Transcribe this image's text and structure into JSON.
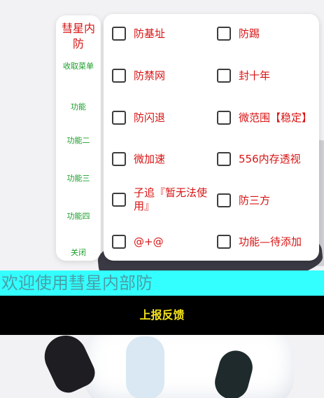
{
  "sidebar": {
    "title": "彗星内防",
    "items": [
      {
        "label": "收取菜单"
      },
      {
        "label": "功能"
      },
      {
        "label": "功能二"
      },
      {
        "label": "功能三"
      },
      {
        "label": "功能四"
      },
      {
        "label": "关闭"
      }
    ]
  },
  "options": [
    {
      "label": "防基址",
      "checked": false
    },
    {
      "label": "防踢",
      "checked": false
    },
    {
      "label": "防禁网",
      "checked": false
    },
    {
      "label": "封十年",
      "checked": false
    },
    {
      "label": "防闪退",
      "checked": false
    },
    {
      "label": "微范围【稳定】",
      "checked": false
    },
    {
      "label": "微加速",
      "checked": false
    },
    {
      "label": "556内存透视",
      "checked": false
    },
    {
      "label": "子追『暂无法使用』",
      "checked": false
    },
    {
      "label": "防三方",
      "checked": false
    },
    {
      "label": "@+@",
      "checked": false
    },
    {
      "label": "功能—待添加",
      "checked": false
    }
  ],
  "welcome_text": "欢迎使用彗星内部防",
  "report_button": "上报反馈",
  "colors": {
    "label_red": "#d81414",
    "nav_green": "#1a9e2a",
    "welcome_bg": "#33ffff",
    "report_bg": "#000000",
    "report_text": "#f3e21b"
  }
}
